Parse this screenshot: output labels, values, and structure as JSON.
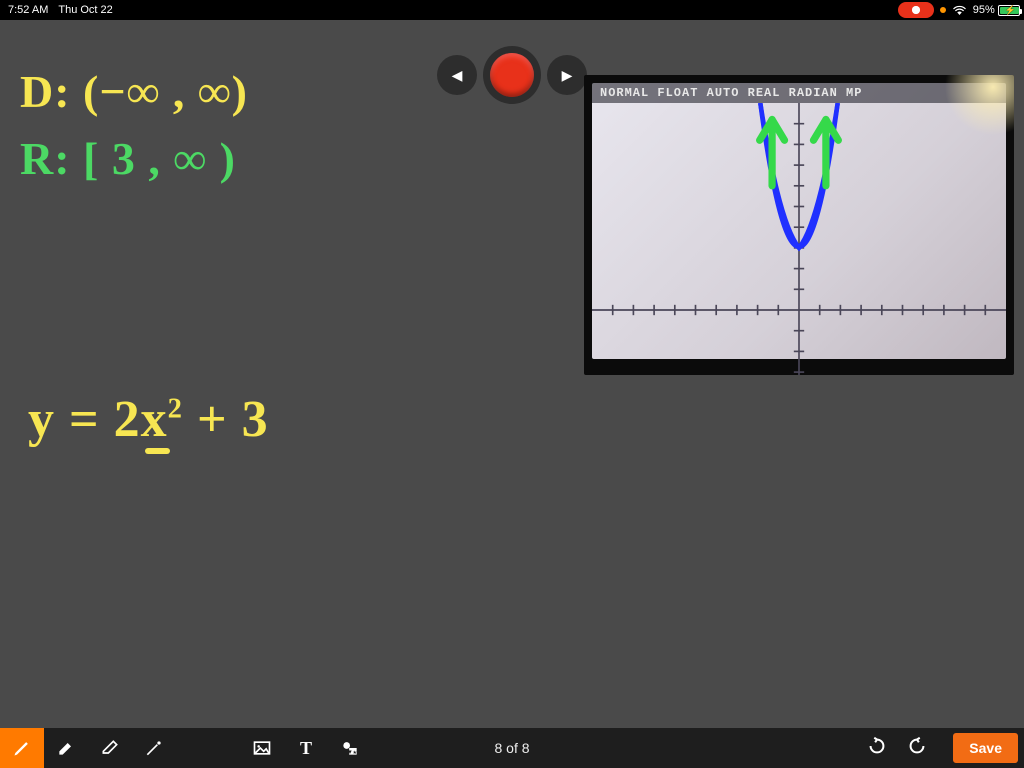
{
  "status": {
    "time": "7:52 AM",
    "date": "Thu Oct 22",
    "battery_percent": "95%",
    "recording_indicator": true,
    "charging": true
  },
  "record_controls": {
    "prev_glyph": "◀",
    "next_glyph": "▶"
  },
  "handwriting": {
    "domain_label": "D:",
    "domain_value": "(−∞ , ∞)",
    "range_label": "R:",
    "range_value": "[ 3 , ∞ )",
    "equation_lhs": "y =",
    "equation_coef": "2",
    "equation_var": "x",
    "equation_exp": "2",
    "equation_tail": "+ 3"
  },
  "calculator": {
    "header": "NORMAL FLOAT AUTO REAL RADIAN MP"
  },
  "chart_data": {
    "type": "line",
    "title": "",
    "xlabel": "",
    "ylabel": "",
    "xlim": [
      -10,
      10
    ],
    "ylim": [
      -10,
      10
    ],
    "series": [
      {
        "name": "y = 2x^2 + 3",
        "x": [
          -2,
          -1.5,
          -1,
          -0.5,
          0,
          0.5,
          1,
          1.5,
          2
        ],
        "values": [
          11,
          7.5,
          5,
          3.5,
          3,
          3.5,
          5,
          7.5,
          11
        ]
      }
    ],
    "annotations": [
      {
        "type": "arrow",
        "at": "left-branch-up",
        "color": "#4cd964"
      },
      {
        "type": "arrow",
        "at": "right-branch-up",
        "color": "#4cd964"
      }
    ]
  },
  "toolbar": {
    "page_indicator": "8 of 8",
    "save_label": "Save",
    "tools": {
      "pen": "pen-icon",
      "highlighter": "highlighter-icon",
      "eraser": "eraser-icon",
      "pointer": "pointer-icon",
      "image": "image-icon",
      "text": "T",
      "shapes": "shapes-icon",
      "undo": "undo-icon",
      "redo": "redo-icon"
    }
  }
}
